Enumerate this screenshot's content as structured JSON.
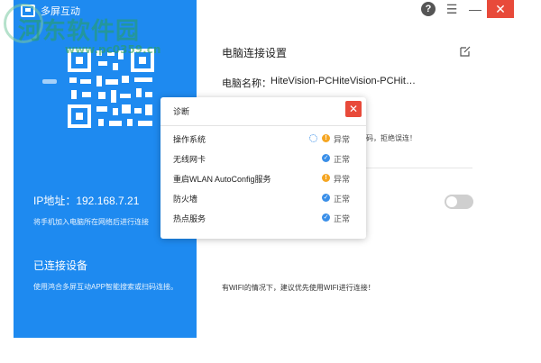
{
  "watermark": {
    "text": "河东软件园",
    "url": "www.pc0359.cn"
  },
  "app": {
    "title": "多屏互动",
    "logo_icon": "screen-logo-icon"
  },
  "window_controls": {
    "help": "?",
    "menu": "☰",
    "minimize": "—",
    "close": "✕"
  },
  "left_panel": {
    "ip_label": "IP地址：192.168.7.21",
    "ip_hint": "将手机加入电脑所在网络后进行连接",
    "connected_title": "已连接设备",
    "connected_hint": "使用鸿合多屏互动APP智能搜索或扫码连接。"
  },
  "right_panel": {
    "section_title": "电脑连接设置",
    "pc_name_label": "电脑名称：",
    "pc_name_value": "HiteVision-PCHiteVision-PCHit…",
    "password_warning": "密码，拒绝误连！",
    "wifi_hint": "有WIFI的情况下，建议优先使用WIFI进行连接！"
  },
  "dialog": {
    "title": "诊断",
    "close": "✕",
    "items": [
      {
        "name": "操作系统",
        "status": "异常",
        "state": "warn",
        "loading": true
      },
      {
        "name": "无线网卡",
        "status": "正常",
        "state": "ok",
        "loading": false
      },
      {
        "name": "重启WLAN AutoConfig服务",
        "status": "异常",
        "state": "warn",
        "loading": false
      },
      {
        "name": "防火墙",
        "status": "正常",
        "state": "ok",
        "loading": false
      },
      {
        "name": "热点服务",
        "status": "正常",
        "state": "ok",
        "loading": false
      }
    ]
  },
  "colors": {
    "brand_blue": "#1e8af0",
    "close_red": "#e84a3a",
    "ok_blue": "#3a8fe8",
    "warn_orange": "#f5a623"
  }
}
